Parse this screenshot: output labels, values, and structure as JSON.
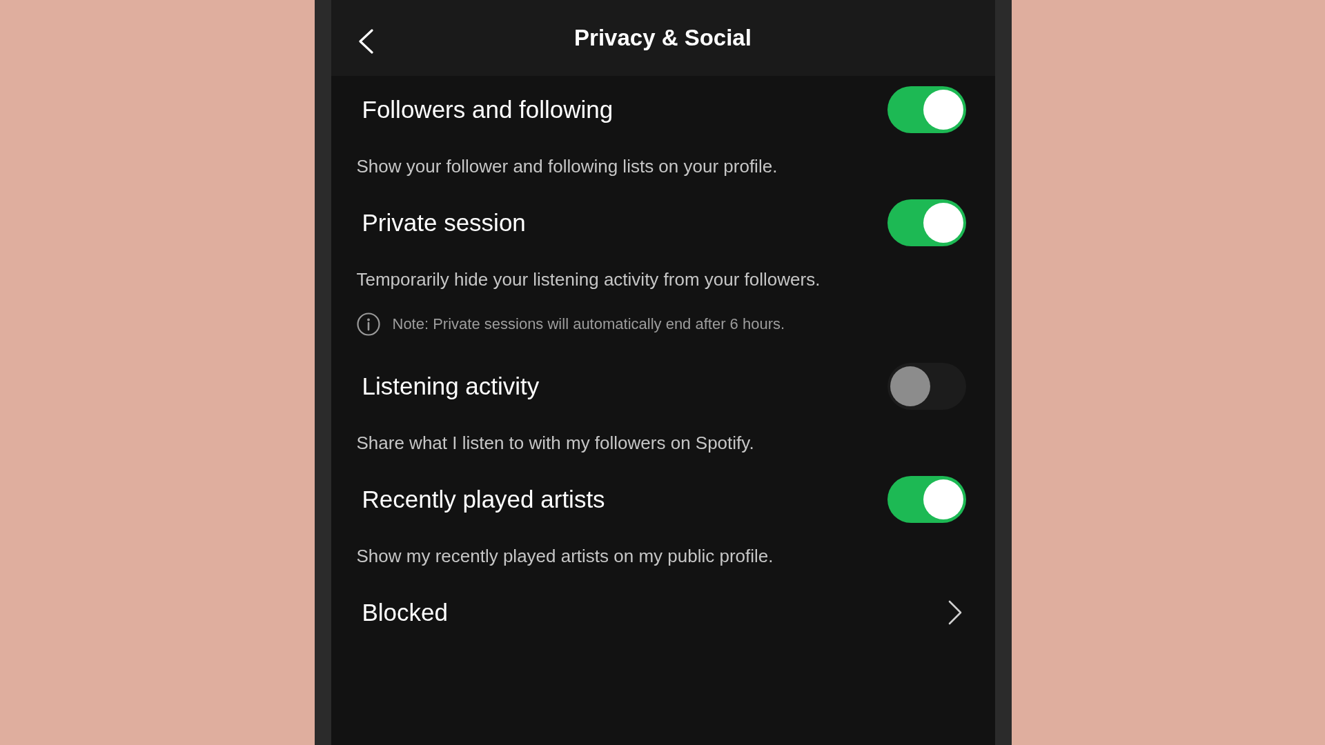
{
  "header": {
    "title": "Privacy & Social"
  },
  "settings": [
    {
      "kind": "toggle",
      "label": "Followers and following",
      "on": true,
      "description": "Show your follower and following lists on your profile."
    },
    {
      "kind": "toggle",
      "label": "Private session",
      "on": true,
      "description": "Temporarily hide your listening activity from your followers.",
      "note": "Note: Private sessions will automatically end after 6 hours."
    },
    {
      "kind": "toggle",
      "label": "Listening activity",
      "on": false,
      "description": "Share what I listen to with my followers on Spotify."
    },
    {
      "kind": "toggle",
      "label": "Recently played artists",
      "on": true,
      "description": "Show my recently played artists on my public profile."
    },
    {
      "kind": "link",
      "label": "Blocked"
    }
  ]
}
